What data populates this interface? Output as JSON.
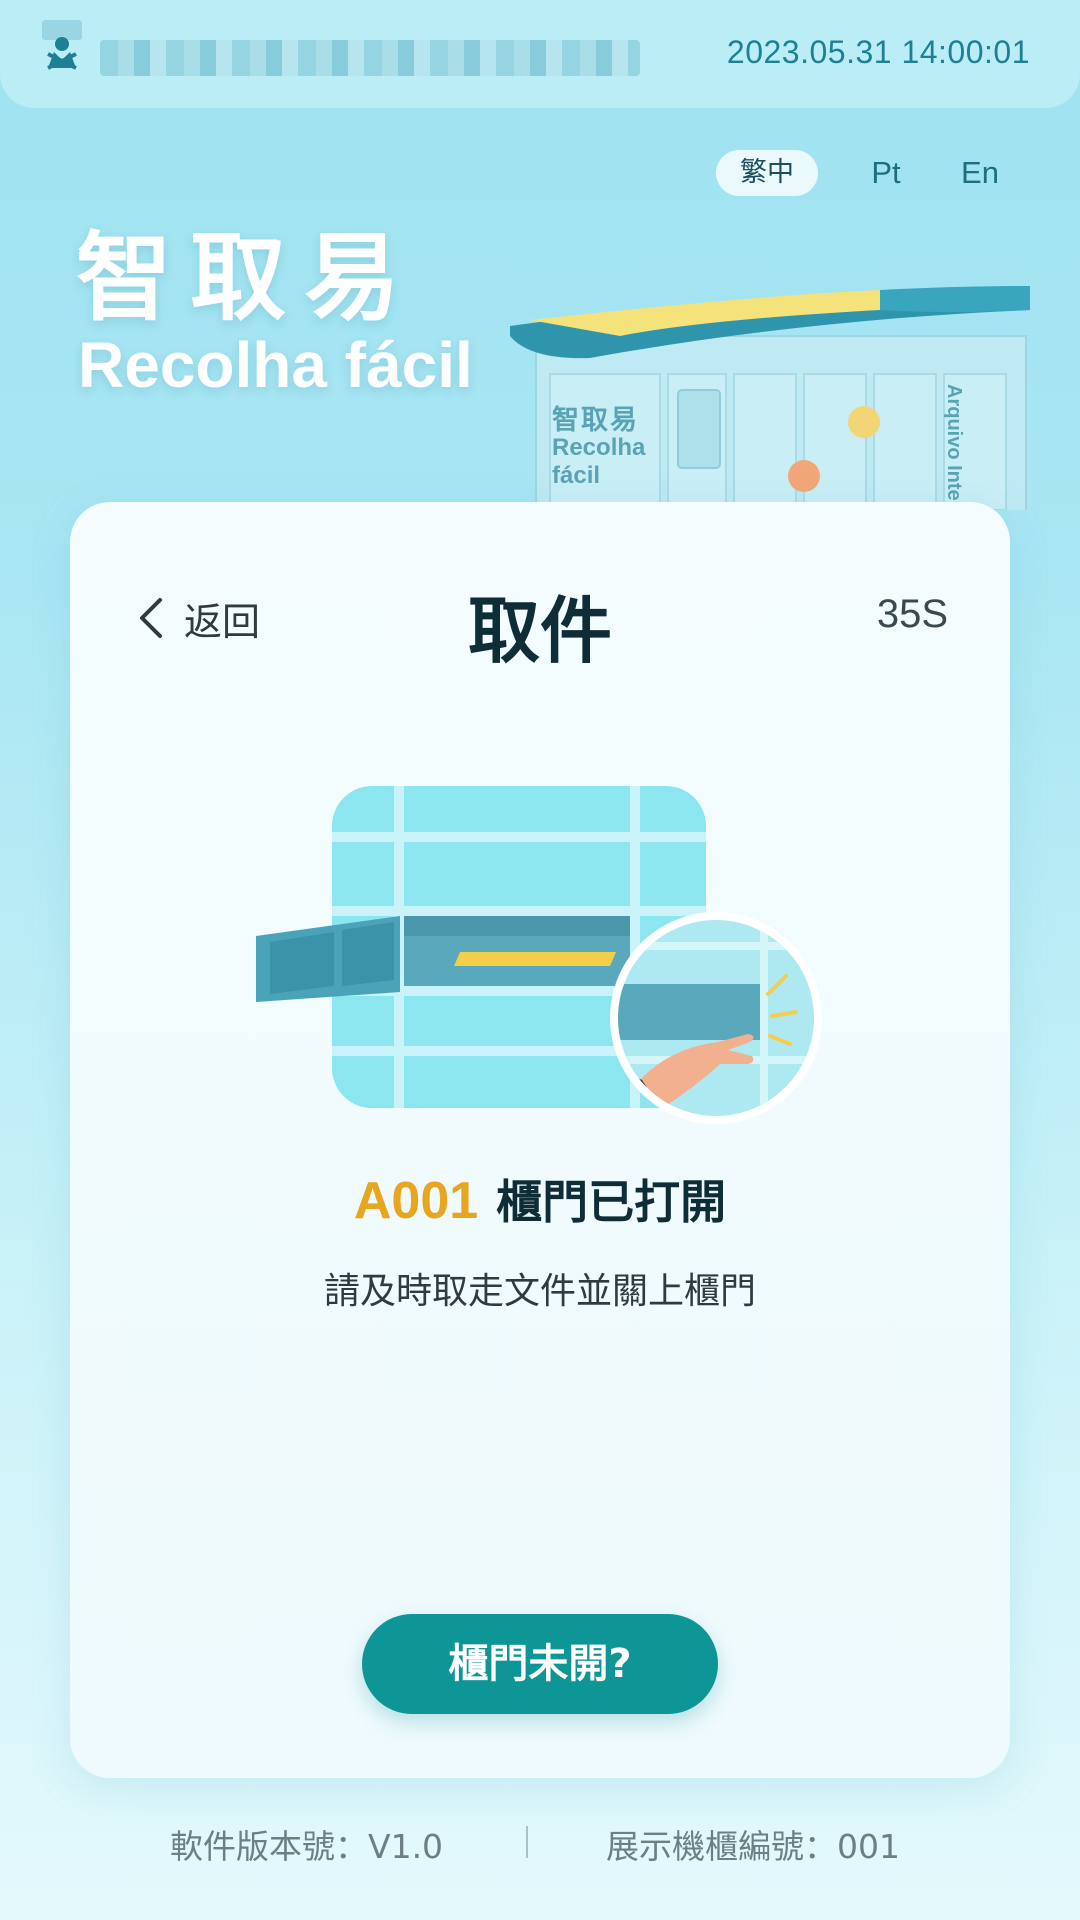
{
  "header": {
    "logo_icon": "courier-person-icon",
    "datetime": "2023.05.31 14:00:01"
  },
  "languages": [
    {
      "label": "繁中",
      "active": true
    },
    {
      "label": "Pt",
      "active": false
    },
    {
      "label": "En",
      "active": false
    }
  ],
  "brand": {
    "name_zh": "智取易",
    "name_pt": "Recolha fácil"
  },
  "kiosk_illustration": {
    "label_zh": "智取易",
    "label_pt": "Recolha fácil",
    "side_text": "Arquivo Inte"
  },
  "page": {
    "back_label": "返回",
    "back_icon": "chevron-left-icon",
    "title": "取件",
    "countdown": "35S"
  },
  "status": {
    "cabinet_id": "A001",
    "message": "櫃門已打開",
    "instruction": "請及時取走文件並關上櫃門"
  },
  "actions": {
    "door_not_open_label": "櫃門未開?"
  },
  "footer": {
    "software_version": "軟件版本號：V1.0",
    "cabinet_number": "展示機櫃編號：001"
  },
  "colors": {
    "accent": "#0e9596",
    "cabinet_highlight": "#e7a520",
    "datetime": "#1d8094"
  }
}
